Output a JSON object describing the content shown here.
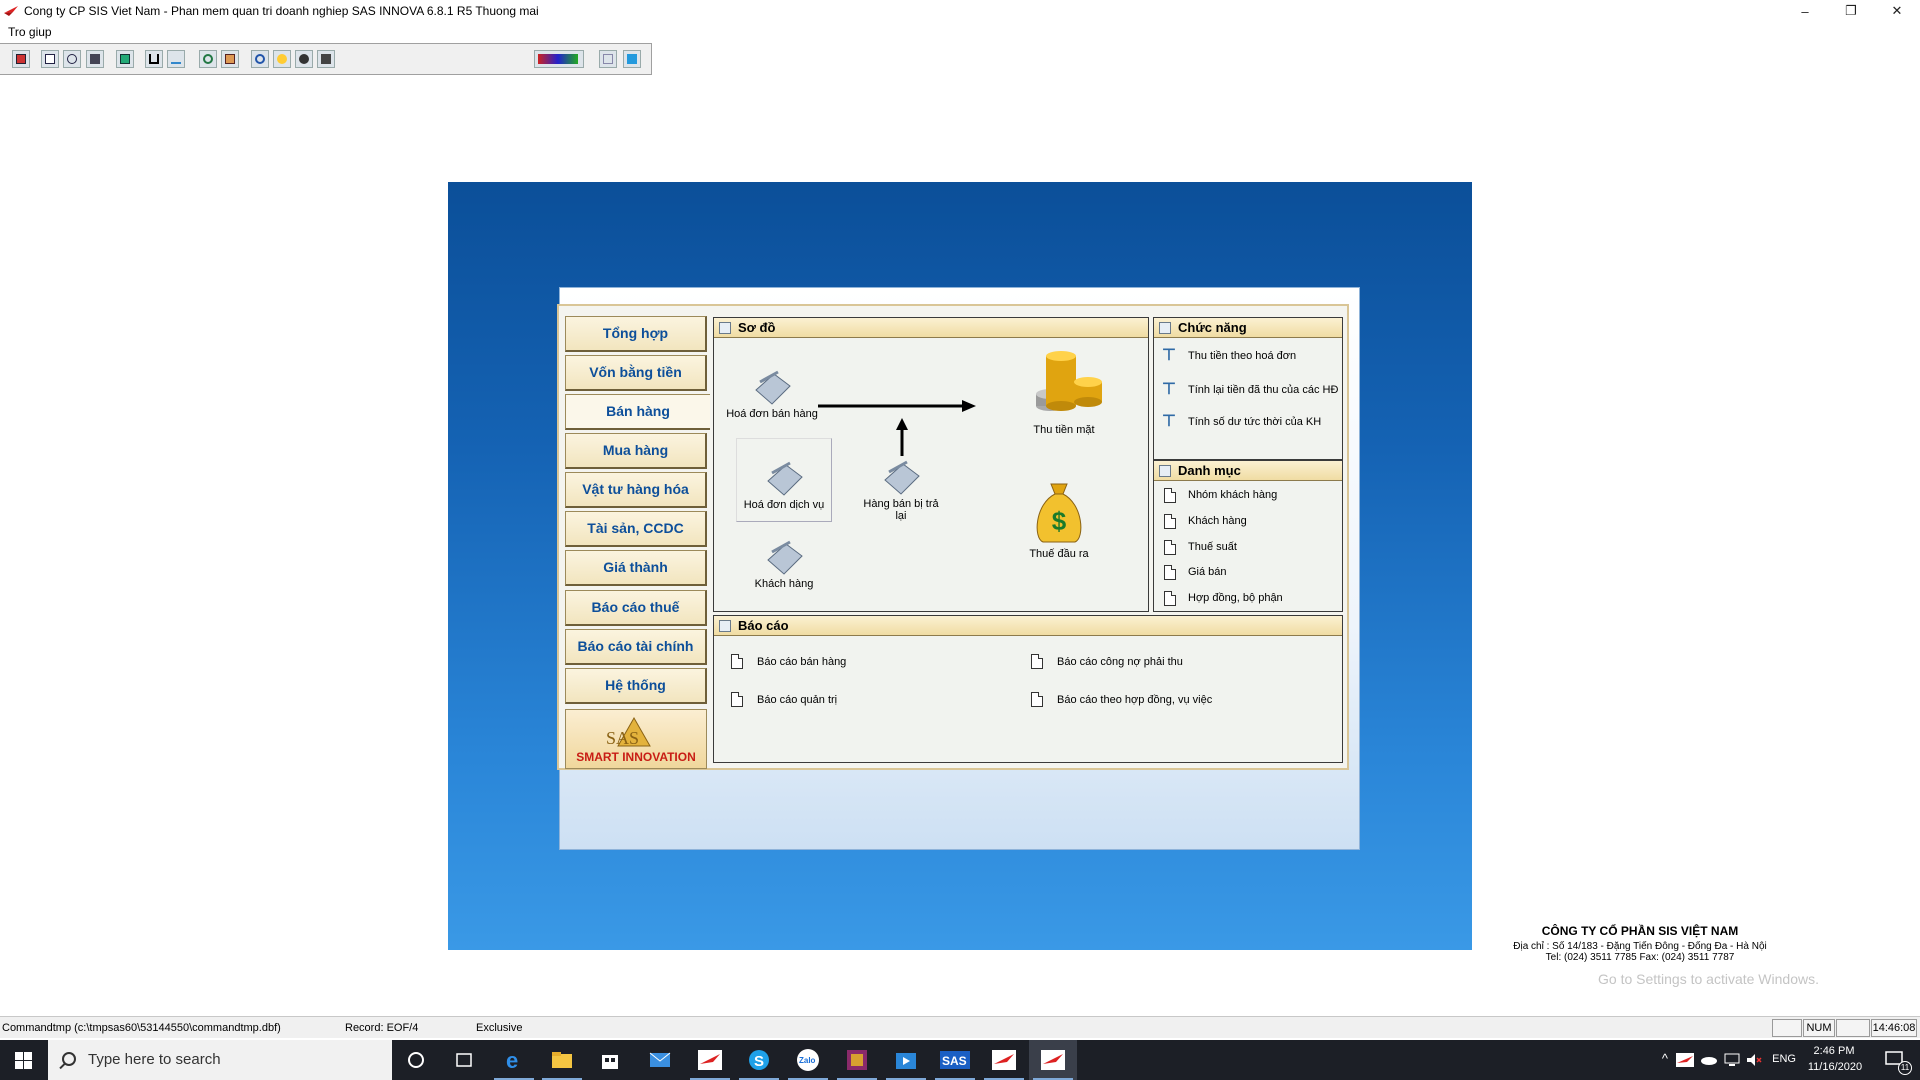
{
  "window": {
    "title": "Cong ty CP SIS Viet Nam - Phan mem quan tri doanh nghiep SAS INNOVA 6.8.1 R5 Thuong mai",
    "minimize_glyph": "–",
    "restore_glyph": "❐",
    "close_glyph": "✕"
  },
  "menu": {
    "help_label": "Tro giup"
  },
  "toolbar": {
    "icons": [
      "flag-icon",
      "copy-icon",
      "cut-icon",
      "paste-icon",
      "calculator-icon",
      "underline-icon",
      "spellcheck-icon",
      "refresh-icon",
      "home-icon",
      "clock-icon",
      "help-icon",
      "user-icon",
      "exit-icon",
      "chart-icon",
      "grid-icon",
      "window-icon"
    ]
  },
  "nav": {
    "items": [
      "Tổng hợp",
      "Vốn bằng tiền",
      "Bán hàng",
      "Mua hàng",
      "Vật tư hàng hóa",
      "Tài sản, CCDC",
      "Giá thành",
      "Báo cáo thuế",
      "Báo cáo tài chính",
      "Hệ thống"
    ],
    "active": "Bán hàng",
    "logo_text": "SMART INNOVATION",
    "logo_letters": "SAS"
  },
  "diagram": {
    "title": "Sơ đồ",
    "sales_invoice": "Hoá đơn bán hàng",
    "service_invoice": "Hoá đơn dịch vụ",
    "customer": "Khách hàng",
    "returns": "Hàng bán bị trả lại",
    "cash_receipt": "Thu tiền mặt",
    "output_tax": "Thuế đầu ra",
    "dollar_glyph": "$"
  },
  "functions": {
    "title": "Chức năng",
    "items": [
      "Thu tiền theo hoá đơn",
      "Tính lại tiền đã thu của các HĐ",
      "Tính số dư tức thời của KH"
    ]
  },
  "catalog": {
    "title": "Danh mục",
    "items": [
      "Nhóm khách hàng",
      "Khách hàng",
      "Thuế suất",
      "Giá bán",
      "Hợp đồng, bộ phận"
    ]
  },
  "reports": {
    "title": "Báo cáo",
    "items": [
      "Báo cáo bán hàng",
      "Báo cáo công nợ phải thu",
      "Báo cáo quản trị",
      "Báo cáo theo hợp đồng, vụ việc"
    ]
  },
  "company": {
    "name": "CÔNG TY CỔ PHẦN SIS VIỆT NAM",
    "address": "Địa chỉ : Số 14/183 - Đặng Tiến Đông - Đống Đa - Hà Nội",
    "phone": "Tel: (024) 3511 7785   Fax: (024) 3511 7787"
  },
  "activation": "Go to Settings to activate Windows.",
  "status": {
    "file": "Commandtmp (c:\\tmpsas60\\53144550\\commandtmp.dbf)",
    "record": "Record: EOF/4",
    "mode": "Exclusive",
    "num": "NUM",
    "time": "14:46:08"
  },
  "taskbar": {
    "search_placeholder": "Type here to search",
    "lang": "ENG",
    "clock_time": "2:46 PM",
    "clock_date": "11/16/2020",
    "notif_count": "11",
    "apps": [
      "cortana-icon",
      "task-view-icon",
      "edge-icon",
      "file-explorer-icon",
      "store-icon",
      "mail-icon",
      "sas-app-icon",
      "skype-icon",
      "zalo-icon",
      "winrar-icon",
      "media-icon",
      "sas-icon",
      "sas-app2-icon",
      "sas-app3-icon"
    ],
    "sas_label": "SAS",
    "zalo_label": "Zalo",
    "skype_label": "S"
  },
  "colors": {
    "nav_text": "#0d4f9a",
    "logo_red": "#c81d15",
    "splash_blue": "#1563b4"
  }
}
